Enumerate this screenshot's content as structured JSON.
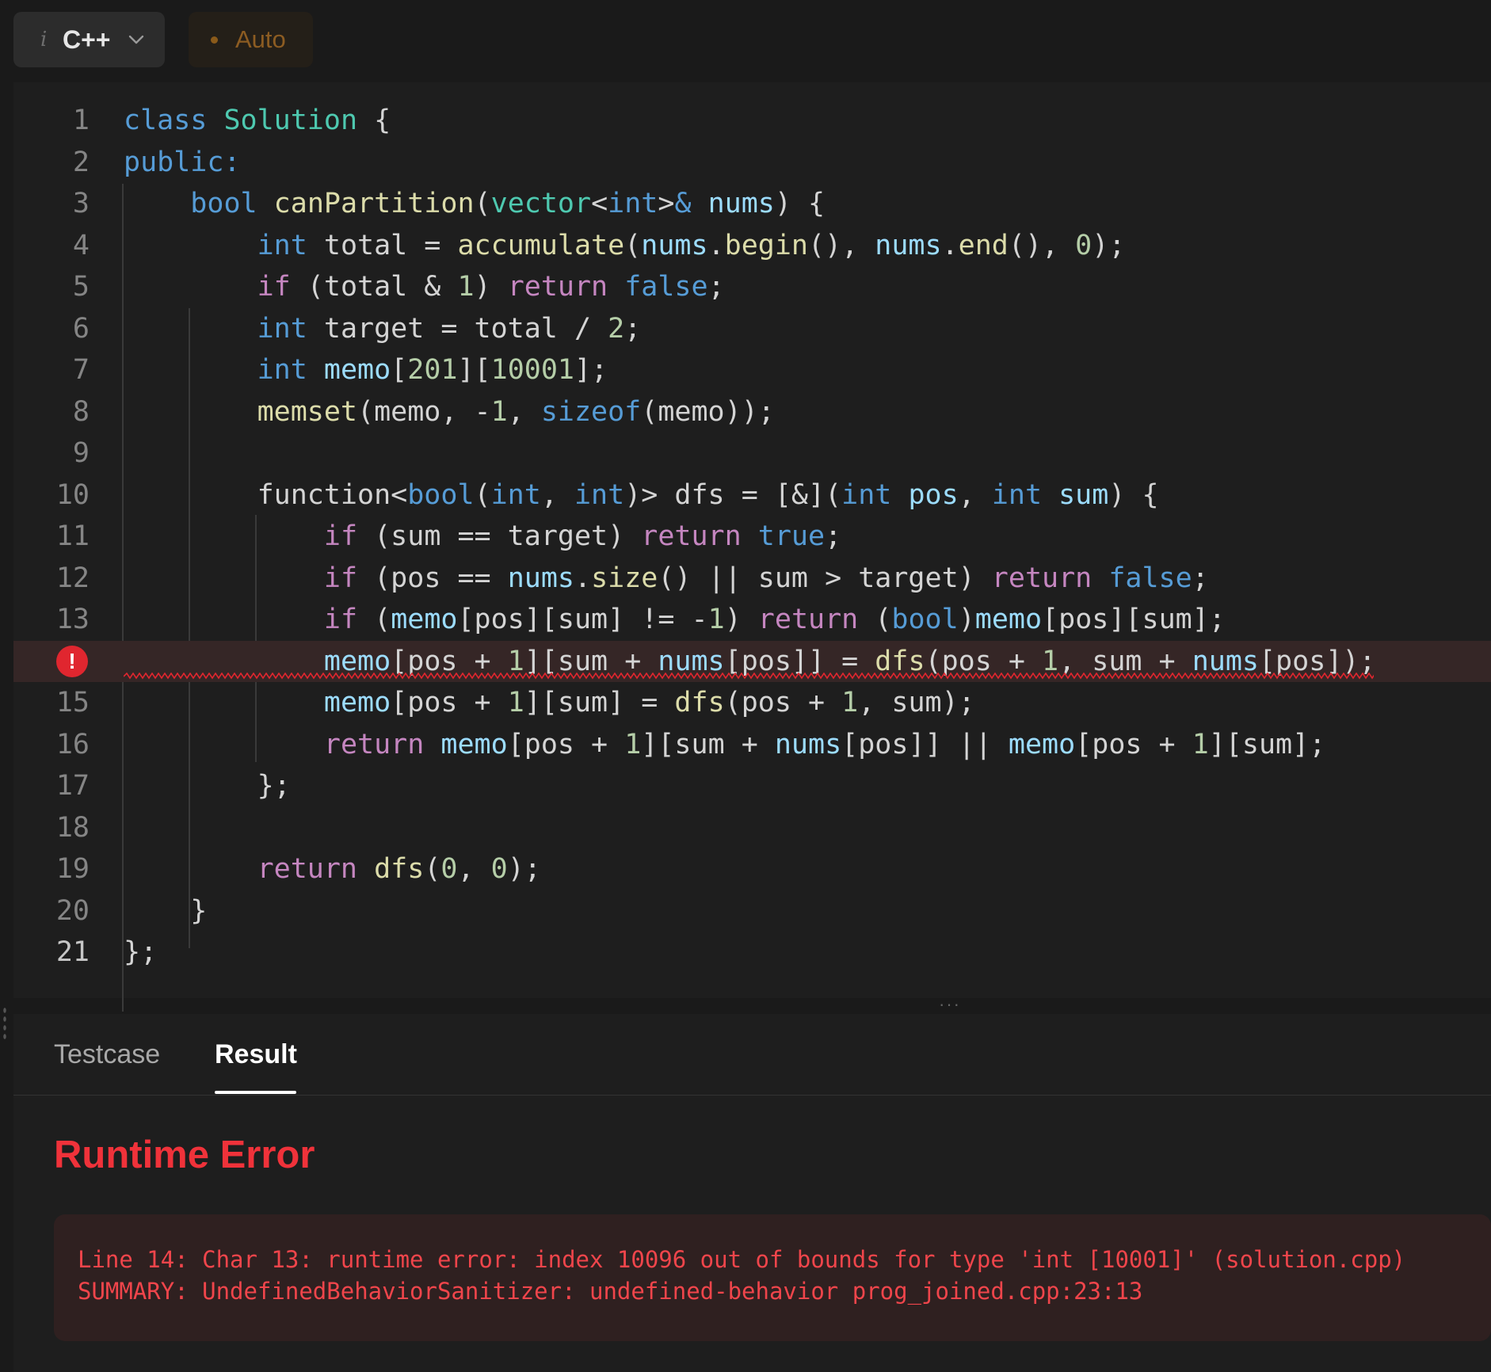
{
  "toolbar": {
    "language": "C++",
    "language_icon": "info-icon",
    "auto_label": "Auto"
  },
  "editor": {
    "error_line": 14,
    "lines": [
      {
        "n": "1",
        "tokens": [
          [
            "kw",
            "class"
          ],
          [
            "txt",
            " "
          ],
          [
            "ty",
            "Solution"
          ],
          [
            "txt",
            " {"
          ]
        ]
      },
      {
        "n": "2",
        "tokens": [
          [
            "kw",
            "public:"
          ]
        ]
      },
      {
        "n": "3",
        "tokens": [
          [
            "txt",
            "    "
          ],
          [
            "kw",
            "bool"
          ],
          [
            "txt",
            " "
          ],
          [
            "fn",
            "canPartition"
          ],
          [
            "txt",
            "("
          ],
          [
            "ty",
            "vector"
          ],
          [
            "txt",
            "<"
          ],
          [
            "kw",
            "int"
          ],
          [
            "txt",
            ">"
          ],
          [
            "kw",
            "&"
          ],
          [
            "txt",
            " "
          ],
          [
            "var",
            "nums"
          ],
          [
            "txt",
            ") {"
          ]
        ]
      },
      {
        "n": "4",
        "tokens": [
          [
            "txt",
            "        "
          ],
          [
            "kw",
            "int"
          ],
          [
            "txt",
            " total = "
          ],
          [
            "fn",
            "accumulate"
          ],
          [
            "txt",
            "("
          ],
          [
            "var",
            "nums"
          ],
          [
            "txt",
            "."
          ],
          [
            "fn",
            "begin"
          ],
          [
            "txt",
            "(), "
          ],
          [
            "var",
            "nums"
          ],
          [
            "txt",
            "."
          ],
          [
            "fn",
            "end"
          ],
          [
            "txt",
            "(), "
          ],
          [
            "num",
            "0"
          ],
          [
            "txt",
            ");"
          ]
        ]
      },
      {
        "n": "5",
        "tokens": [
          [
            "txt",
            "        "
          ],
          [
            "ctl",
            "if"
          ],
          [
            "txt",
            " (total & "
          ],
          [
            "num",
            "1"
          ],
          [
            "txt",
            ") "
          ],
          [
            "ctl",
            "return"
          ],
          [
            "txt",
            " "
          ],
          [
            "kw",
            "false"
          ],
          [
            "txt",
            ";"
          ]
        ]
      },
      {
        "n": "6",
        "tokens": [
          [
            "txt",
            "        "
          ],
          [
            "kw",
            "int"
          ],
          [
            "txt",
            " target = total / "
          ],
          [
            "num",
            "2"
          ],
          [
            "txt",
            ";"
          ]
        ]
      },
      {
        "n": "7",
        "tokens": [
          [
            "txt",
            "        "
          ],
          [
            "kw",
            "int"
          ],
          [
            "txt",
            " "
          ],
          [
            "var",
            "memo"
          ],
          [
            "txt",
            "["
          ],
          [
            "num",
            "201"
          ],
          [
            "txt",
            "]["
          ],
          [
            "num",
            "10001"
          ],
          [
            "txt",
            "];"
          ]
        ]
      },
      {
        "n": "8",
        "tokens": [
          [
            "txt",
            "        "
          ],
          [
            "fn",
            "memset"
          ],
          [
            "txt",
            "(memo, -"
          ],
          [
            "num",
            "1"
          ],
          [
            "txt",
            ", "
          ],
          [
            "kw",
            "sizeof"
          ],
          [
            "txt",
            "(memo));"
          ]
        ]
      },
      {
        "n": "9",
        "tokens": []
      },
      {
        "n": "10",
        "tokens": [
          [
            "txt",
            "        function<"
          ],
          [
            "kw",
            "bool"
          ],
          [
            "txt",
            "("
          ],
          [
            "kw",
            "int"
          ],
          [
            "txt",
            ", "
          ],
          [
            "kw",
            "int"
          ],
          [
            "txt",
            ")> dfs = [&]("
          ],
          [
            "kw",
            "int"
          ],
          [
            "txt",
            " "
          ],
          [
            "var",
            "pos"
          ],
          [
            "txt",
            ", "
          ],
          [
            "kw",
            "int"
          ],
          [
            "txt",
            " "
          ],
          [
            "var",
            "sum"
          ],
          [
            "txt",
            ") {"
          ]
        ]
      },
      {
        "n": "11",
        "tokens": [
          [
            "txt",
            "            "
          ],
          [
            "ctl",
            "if"
          ],
          [
            "txt",
            " (sum == target) "
          ],
          [
            "ctl",
            "return"
          ],
          [
            "txt",
            " "
          ],
          [
            "kw",
            "true"
          ],
          [
            "txt",
            ";"
          ]
        ]
      },
      {
        "n": "12",
        "tokens": [
          [
            "txt",
            "            "
          ],
          [
            "ctl",
            "if"
          ],
          [
            "txt",
            " (pos == "
          ],
          [
            "var",
            "nums"
          ],
          [
            "txt",
            "."
          ],
          [
            "fn",
            "size"
          ],
          [
            "txt",
            "() || sum > target) "
          ],
          [
            "ctl",
            "return"
          ],
          [
            "txt",
            " "
          ],
          [
            "kw",
            "false"
          ],
          [
            "txt",
            ";"
          ]
        ]
      },
      {
        "n": "13",
        "tokens": [
          [
            "txt",
            "            "
          ],
          [
            "ctl",
            "if"
          ],
          [
            "txt",
            " ("
          ],
          [
            "var",
            "memo"
          ],
          [
            "txt",
            "[pos][sum] != -"
          ],
          [
            "num",
            "1"
          ],
          [
            "txt",
            ") "
          ],
          [
            "ctl",
            "return"
          ],
          [
            "txt",
            " ("
          ],
          [
            "kw",
            "bool"
          ],
          [
            "txt",
            ")"
          ],
          [
            "var",
            "memo"
          ],
          [
            "txt",
            "[pos][sum];"
          ]
        ]
      },
      {
        "n": "14",
        "tokens": [
          [
            "txt",
            "            "
          ],
          [
            "var",
            "memo"
          ],
          [
            "txt",
            "[pos + "
          ],
          [
            "num",
            "1"
          ],
          [
            "txt",
            "][sum + "
          ],
          [
            "var",
            "nums"
          ],
          [
            "txt",
            "[pos]] = "
          ],
          [
            "fn",
            "dfs"
          ],
          [
            "txt",
            "(pos + "
          ],
          [
            "num",
            "1"
          ],
          [
            "txt",
            ", sum + "
          ],
          [
            "var",
            "nums"
          ],
          [
            "txt",
            "[pos]);"
          ]
        ]
      },
      {
        "n": "15",
        "tokens": [
          [
            "txt",
            "            "
          ],
          [
            "var",
            "memo"
          ],
          [
            "txt",
            "[pos + "
          ],
          [
            "num",
            "1"
          ],
          [
            "txt",
            "][sum] = "
          ],
          [
            "fn",
            "dfs"
          ],
          [
            "txt",
            "(pos + "
          ],
          [
            "num",
            "1"
          ],
          [
            "txt",
            ", sum);"
          ]
        ]
      },
      {
        "n": "16",
        "tokens": [
          [
            "txt",
            "            "
          ],
          [
            "ctl",
            "return"
          ],
          [
            "txt",
            " "
          ],
          [
            "var",
            "memo"
          ],
          [
            "txt",
            "[pos + "
          ],
          [
            "num",
            "1"
          ],
          [
            "txt",
            "][sum + "
          ],
          [
            "var",
            "nums"
          ],
          [
            "txt",
            "[pos]] || "
          ],
          [
            "var",
            "memo"
          ],
          [
            "txt",
            "[pos + "
          ],
          [
            "num",
            "1"
          ],
          [
            "txt",
            "][sum];"
          ]
        ]
      },
      {
        "n": "17",
        "tokens": [
          [
            "txt",
            "        };"
          ]
        ]
      },
      {
        "n": "18",
        "tokens": []
      },
      {
        "n": "19",
        "tokens": [
          [
            "txt",
            "        "
          ],
          [
            "ctl",
            "return"
          ],
          [
            "txt",
            " "
          ],
          [
            "fn",
            "dfs"
          ],
          [
            "txt",
            "("
          ],
          [
            "num",
            "0"
          ],
          [
            "txt",
            ", "
          ],
          [
            "num",
            "0"
          ],
          [
            "txt",
            ");"
          ]
        ]
      },
      {
        "n": "20",
        "tokens": [
          [
            "txt",
            "    }"
          ]
        ]
      },
      {
        "n": "21",
        "tokens": [
          [
            "txt",
            "};"
          ]
        ]
      }
    ]
  },
  "panel": {
    "tabs": [
      "Testcase",
      "Result"
    ],
    "active_tab": "Result",
    "status": "Runtime Error",
    "error_lines": [
      "Line 14: Char 13: runtime error: index 10096 out of bounds for type 'int [10001]' (solution.cpp)",
      "SUMMARY: UndefinedBehaviorSanitizer: undefined-behavior prog_joined.cpp:23:13"
    ]
  },
  "colors": {
    "keyword": "#569cd6",
    "type": "#4ec9b0",
    "function": "#dcdcaa",
    "control": "#c586c0",
    "variable": "#9cdcfe",
    "number": "#b5cea8",
    "error": "#f0323a"
  }
}
